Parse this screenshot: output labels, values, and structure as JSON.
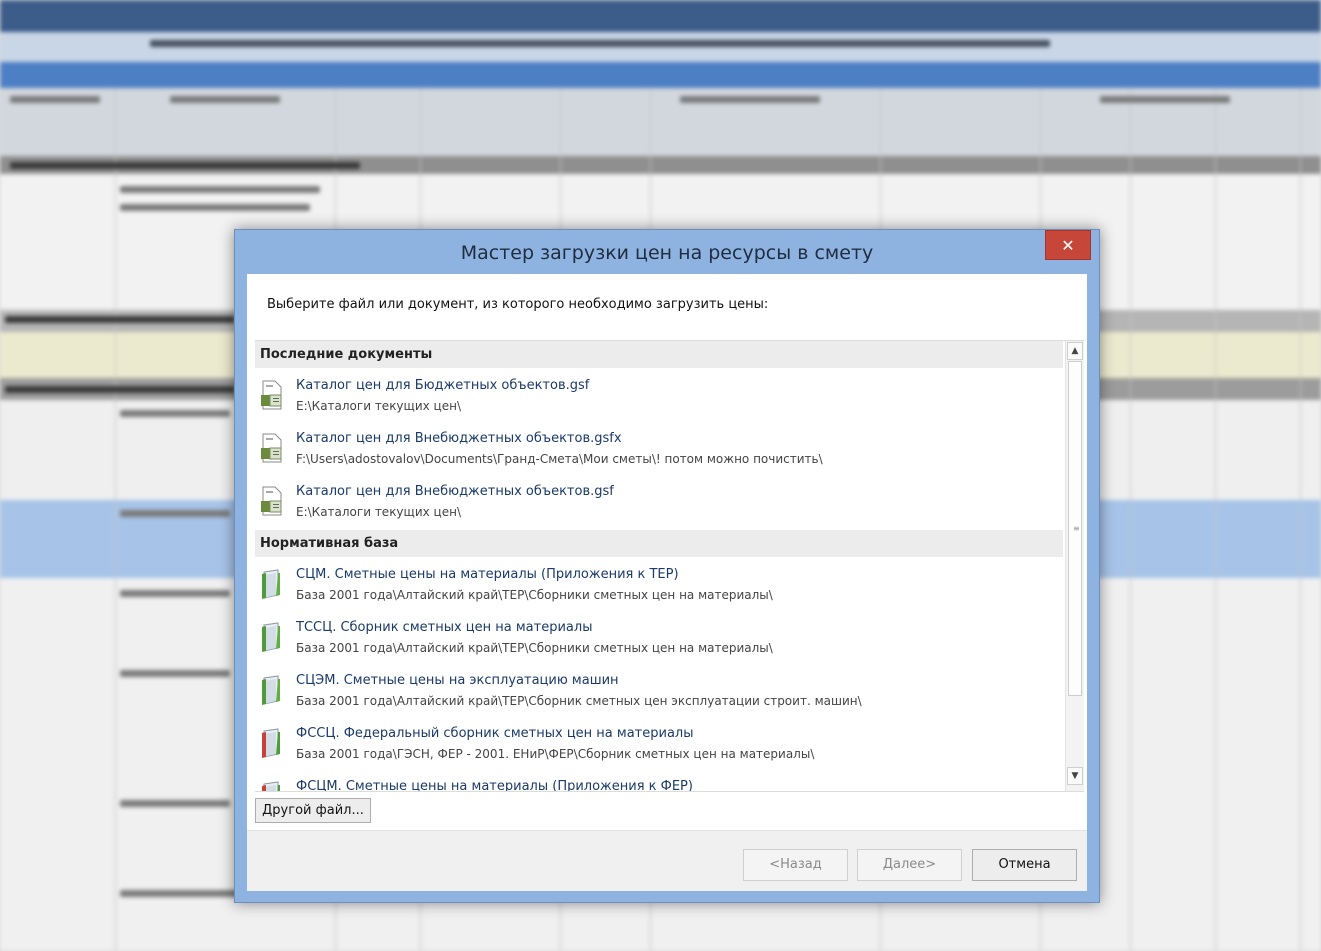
{
  "dialog": {
    "title": "Мастер загрузки цен на ресурсы в смету",
    "close_label": "✕",
    "prompt": "Выберите файл или документ, из которого необходимо загрузить цены:",
    "groups": [
      {
        "header": "Последние документы",
        "items": [
          {
            "name": "Каталог цен для Бюджетных объектов.gsf",
            "path": "E:\\Каталоги текущих цен\\",
            "icon": "spreadsheet-file-icon"
          },
          {
            "name": "Каталог цен для Внебюджетных объектов.gsfx",
            "path": "F:\\Users\\adostovalov\\Documents\\Гранд-Смета\\Мои сметы\\! потом можно почистить\\",
            "icon": "spreadsheet-file-icon"
          },
          {
            "name": "Каталог цен для Внебюджетных объектов.gsf",
            "path": "E:\\Каталоги текущих цен\\",
            "icon": "spreadsheet-file-icon"
          }
        ]
      },
      {
        "header": "Нормативная база",
        "items": [
          {
            "name": "СЦМ. Сметные цены на материалы (Приложения к ТЕР)",
            "path": "База 2001 года\\Алтайский край\\ТЕР\\Сборники сметных цен на материалы\\",
            "icon": "green-book-icon"
          },
          {
            "name": "ТССЦ. Сборник сметных цен на материалы",
            "path": "База 2001 года\\Алтайский край\\ТЕР\\Сборники сметных цен на материалы\\",
            "icon": "green-book-icon"
          },
          {
            "name": "СЦЭМ. Сметные цены на эксплуатацию машин",
            "path": "База 2001 года\\Алтайский край\\ТЕР\\Сборник сметных цен эксплуатации строит. машин\\",
            "icon": "green-book-icon"
          },
          {
            "name": "ФССЦ. Федеральный сборник сметных цен на материалы",
            "path": "База 2001 года\\ГЭСН, ФЕР - 2001. ЕНиР\\ФЕР\\Сборник сметных цен на материалы\\",
            "icon": "red-book-icon"
          },
          {
            "name": "ФСЦМ. Сметные цены на материалы (Приложения к ФЕР)",
            "path": "",
            "icon": "red-book-icon"
          }
        ]
      }
    ],
    "other_file_label": "Другой файл...",
    "back_label": "<Назад",
    "next_label": "Далее>",
    "cancel_label": "Отмена"
  },
  "colors": {
    "frame": "#8fb3e0",
    "close": "#c7463a",
    "link_text": "#1a3a6a"
  }
}
